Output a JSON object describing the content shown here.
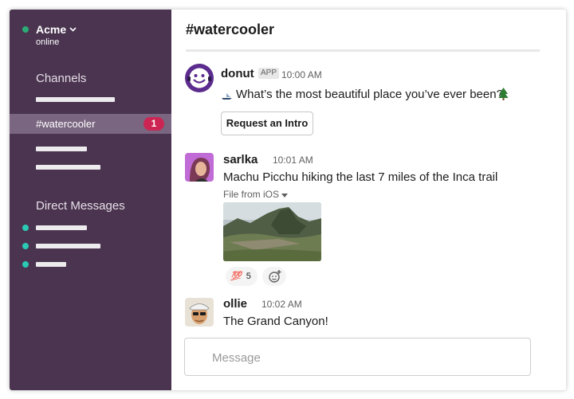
{
  "workspace": {
    "name": "Acme",
    "status": "online"
  },
  "sidebar": {
    "channels_title": "Channels",
    "active_channel": {
      "label": "#watercooler",
      "unread_count": "1"
    },
    "dm_title": "Direct Messages"
  },
  "channel": {
    "title": "#watercooler"
  },
  "messages": [
    {
      "author": "donut",
      "tag": "APP",
      "time": "10:00 AM",
      "text": "What’s the most beautiful place you’ve ever been?",
      "action_label": "Request an Intro"
    },
    {
      "author": "sarlka",
      "time": "10:01 AM",
      "text": "Machu Picchu hiking the last 7 miles of the Inca trail",
      "file_label": "File from iOS",
      "reaction_emoji": "💯",
      "reaction_count": "5"
    },
    {
      "author": "ollie",
      "time": "10:02 AM",
      "text": "The Grand Canyon!"
    }
  ],
  "composer": {
    "placeholder": "Message"
  },
  "colors": {
    "sidebar": "#4a3450",
    "active_channel": "#7a6680",
    "badge": "#cd2553",
    "presence": "#2bac76",
    "dm_dot": "#2bc9b4",
    "donut_avatar": "#5b2c8e"
  },
  "icons": {
    "workspace_menu": "chevron-down-icon",
    "file_menu": "caret-down-icon",
    "add_reaction": "add-reaction-icon",
    "boat": "sailboat-emoji",
    "tree": "tree-emoji"
  }
}
